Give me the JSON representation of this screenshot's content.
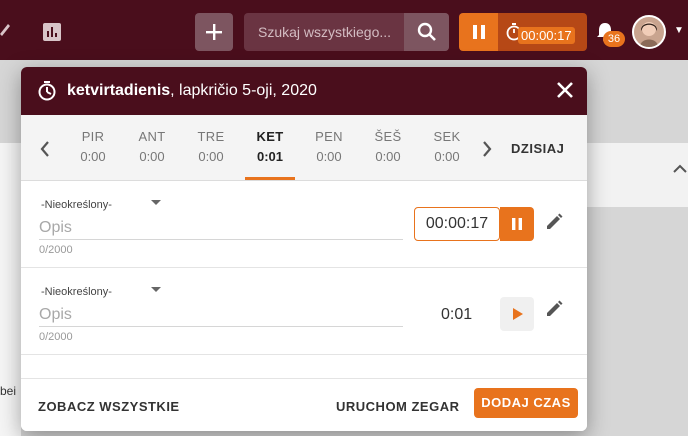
{
  "topbar": {
    "search_placeholder": "Szukaj wszystkiego...",
    "timer": "00:00:17",
    "notifications": "36"
  },
  "background": {
    "partial_text": "bei"
  },
  "dialog": {
    "title_bold": "ketvirtadienis",
    "title_rest": ", lapkričio 5-oji, 2020",
    "today_label": "DZISIAJ",
    "days": [
      {
        "name": "PIR",
        "value": "0:00"
      },
      {
        "name": "ANT",
        "value": "0:00"
      },
      {
        "name": "TRE",
        "value": "0:00"
      },
      {
        "name": "KET",
        "value": "0:01"
      },
      {
        "name": "PEN",
        "value": "0:00"
      },
      {
        "name": "ŠEŠ",
        "value": "0:00"
      },
      {
        "name": "SEK",
        "value": "0:00"
      }
    ],
    "entries": [
      {
        "project": "-Nieokreślony-",
        "placeholder": "Opis",
        "counter": "0/2000",
        "time": "00:00:17"
      },
      {
        "project": "-Nieokreślony-",
        "placeholder": "Opis",
        "counter": "0/2000",
        "time": "0:01"
      }
    ],
    "footer": {
      "see_all": "ZOBACZ WSZYSTKIE",
      "start_timer": "URUCHOM ZEGAR",
      "add_time": "DODAJ CZAS"
    }
  },
  "colors": {
    "brand": "#4a0e1c",
    "accent": "#e8731d"
  }
}
